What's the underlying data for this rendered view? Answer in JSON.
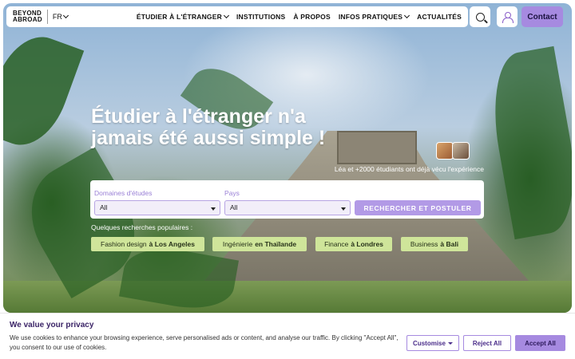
{
  "nav": {
    "logo_line1": "BEYOND",
    "logo_line2": "ABROAD",
    "lang": "FR",
    "links": [
      {
        "label": "ÉTUDIER À L'ÉTRANGER",
        "dropdown": true
      },
      {
        "label": "INSTITUTIONS",
        "dropdown": false
      },
      {
        "label": "À PROPOS",
        "dropdown": false
      },
      {
        "label": "INFOS PRATIQUES",
        "dropdown": true
      },
      {
        "label": "ACTUALITÉS",
        "dropdown": false
      }
    ],
    "contact_label": "Contact",
    "search_icon": "search-icon",
    "account_icon": "user-icon"
  },
  "hero": {
    "headline": "Étudier à l'étranger n'a jamais été aussi simple !",
    "students_text": "Léa et +2000 étudiants ont déjà vécu l'expérience"
  },
  "search": {
    "domain_label": "Domaines d'études",
    "domain_value": "All",
    "country_label": "Pays",
    "country_value": "All",
    "button_label": "RECHERCHER ET POSTULER",
    "popular_label": "Quelques recherches populaires :",
    "popular": [
      {
        "topic": "Fashion design",
        "place": "à Los Angeles"
      },
      {
        "topic": "Ingénierie",
        "place": "en Thaïlande"
      },
      {
        "topic": "Finance",
        "place": "à Londres"
      },
      {
        "topic": "Business",
        "place": "à Bali"
      }
    ]
  },
  "cookie": {
    "title": "We value your privacy",
    "text": "We use cookies to enhance your browsing experience, serve personalised ads or content, and analyse our traffic. By clicking \"Accept All\", you consent to our use of cookies.",
    "customise_label": "Customise",
    "reject_label": "Reject All",
    "accept_label": "Accept All"
  },
  "colors": {
    "accent": "#a68ae0",
    "chip": "#cfe59a",
    "cookie_title": "#3b2467"
  }
}
